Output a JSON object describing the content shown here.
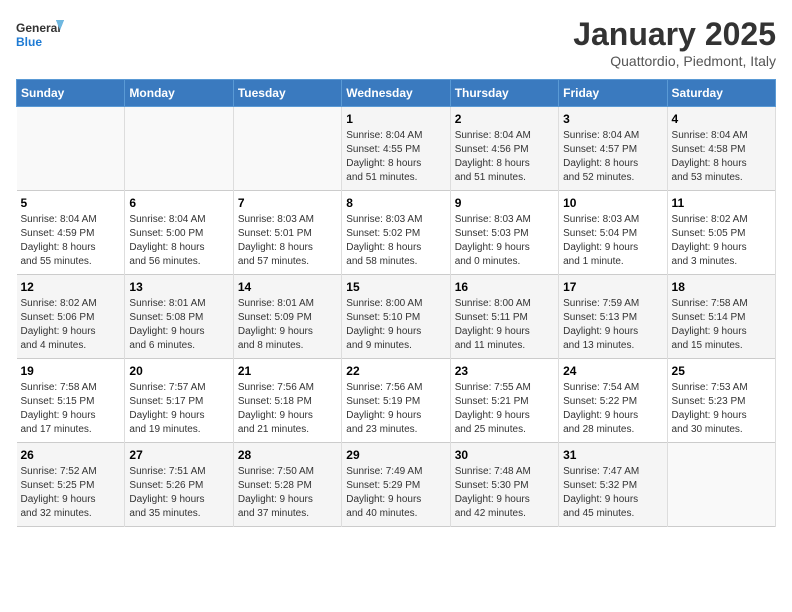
{
  "logo": {
    "line1": "General",
    "line2": "Blue"
  },
  "title": "January 2025",
  "subtitle": "Quattordio, Piedmont, Italy",
  "weekdays": [
    "Sunday",
    "Monday",
    "Tuesday",
    "Wednesday",
    "Thursday",
    "Friday",
    "Saturday"
  ],
  "weeks": [
    [
      {
        "day": "",
        "info": ""
      },
      {
        "day": "",
        "info": ""
      },
      {
        "day": "",
        "info": ""
      },
      {
        "day": "1",
        "info": "Sunrise: 8:04 AM\nSunset: 4:55 PM\nDaylight: 8 hours\nand 51 minutes."
      },
      {
        "day": "2",
        "info": "Sunrise: 8:04 AM\nSunset: 4:56 PM\nDaylight: 8 hours\nand 51 minutes."
      },
      {
        "day": "3",
        "info": "Sunrise: 8:04 AM\nSunset: 4:57 PM\nDaylight: 8 hours\nand 52 minutes."
      },
      {
        "day": "4",
        "info": "Sunrise: 8:04 AM\nSunset: 4:58 PM\nDaylight: 8 hours\nand 53 minutes."
      }
    ],
    [
      {
        "day": "5",
        "info": "Sunrise: 8:04 AM\nSunset: 4:59 PM\nDaylight: 8 hours\nand 55 minutes."
      },
      {
        "day": "6",
        "info": "Sunrise: 8:04 AM\nSunset: 5:00 PM\nDaylight: 8 hours\nand 56 minutes."
      },
      {
        "day": "7",
        "info": "Sunrise: 8:03 AM\nSunset: 5:01 PM\nDaylight: 8 hours\nand 57 minutes."
      },
      {
        "day": "8",
        "info": "Sunrise: 8:03 AM\nSunset: 5:02 PM\nDaylight: 8 hours\nand 58 minutes."
      },
      {
        "day": "9",
        "info": "Sunrise: 8:03 AM\nSunset: 5:03 PM\nDaylight: 9 hours\nand 0 minutes."
      },
      {
        "day": "10",
        "info": "Sunrise: 8:03 AM\nSunset: 5:04 PM\nDaylight: 9 hours\nand 1 minute."
      },
      {
        "day": "11",
        "info": "Sunrise: 8:02 AM\nSunset: 5:05 PM\nDaylight: 9 hours\nand 3 minutes."
      }
    ],
    [
      {
        "day": "12",
        "info": "Sunrise: 8:02 AM\nSunset: 5:06 PM\nDaylight: 9 hours\nand 4 minutes."
      },
      {
        "day": "13",
        "info": "Sunrise: 8:01 AM\nSunset: 5:08 PM\nDaylight: 9 hours\nand 6 minutes."
      },
      {
        "day": "14",
        "info": "Sunrise: 8:01 AM\nSunset: 5:09 PM\nDaylight: 9 hours\nand 8 minutes."
      },
      {
        "day": "15",
        "info": "Sunrise: 8:00 AM\nSunset: 5:10 PM\nDaylight: 9 hours\nand 9 minutes."
      },
      {
        "day": "16",
        "info": "Sunrise: 8:00 AM\nSunset: 5:11 PM\nDaylight: 9 hours\nand 11 minutes."
      },
      {
        "day": "17",
        "info": "Sunrise: 7:59 AM\nSunset: 5:13 PM\nDaylight: 9 hours\nand 13 minutes."
      },
      {
        "day": "18",
        "info": "Sunrise: 7:58 AM\nSunset: 5:14 PM\nDaylight: 9 hours\nand 15 minutes."
      }
    ],
    [
      {
        "day": "19",
        "info": "Sunrise: 7:58 AM\nSunset: 5:15 PM\nDaylight: 9 hours\nand 17 minutes."
      },
      {
        "day": "20",
        "info": "Sunrise: 7:57 AM\nSunset: 5:17 PM\nDaylight: 9 hours\nand 19 minutes."
      },
      {
        "day": "21",
        "info": "Sunrise: 7:56 AM\nSunset: 5:18 PM\nDaylight: 9 hours\nand 21 minutes."
      },
      {
        "day": "22",
        "info": "Sunrise: 7:56 AM\nSunset: 5:19 PM\nDaylight: 9 hours\nand 23 minutes."
      },
      {
        "day": "23",
        "info": "Sunrise: 7:55 AM\nSunset: 5:21 PM\nDaylight: 9 hours\nand 25 minutes."
      },
      {
        "day": "24",
        "info": "Sunrise: 7:54 AM\nSunset: 5:22 PM\nDaylight: 9 hours\nand 28 minutes."
      },
      {
        "day": "25",
        "info": "Sunrise: 7:53 AM\nSunset: 5:23 PM\nDaylight: 9 hours\nand 30 minutes."
      }
    ],
    [
      {
        "day": "26",
        "info": "Sunrise: 7:52 AM\nSunset: 5:25 PM\nDaylight: 9 hours\nand 32 minutes."
      },
      {
        "day": "27",
        "info": "Sunrise: 7:51 AM\nSunset: 5:26 PM\nDaylight: 9 hours\nand 35 minutes."
      },
      {
        "day": "28",
        "info": "Sunrise: 7:50 AM\nSunset: 5:28 PM\nDaylight: 9 hours\nand 37 minutes."
      },
      {
        "day": "29",
        "info": "Sunrise: 7:49 AM\nSunset: 5:29 PM\nDaylight: 9 hours\nand 40 minutes."
      },
      {
        "day": "30",
        "info": "Sunrise: 7:48 AM\nSunset: 5:30 PM\nDaylight: 9 hours\nand 42 minutes."
      },
      {
        "day": "31",
        "info": "Sunrise: 7:47 AM\nSunset: 5:32 PM\nDaylight: 9 hours\nand 45 minutes."
      },
      {
        "day": "",
        "info": ""
      }
    ]
  ]
}
